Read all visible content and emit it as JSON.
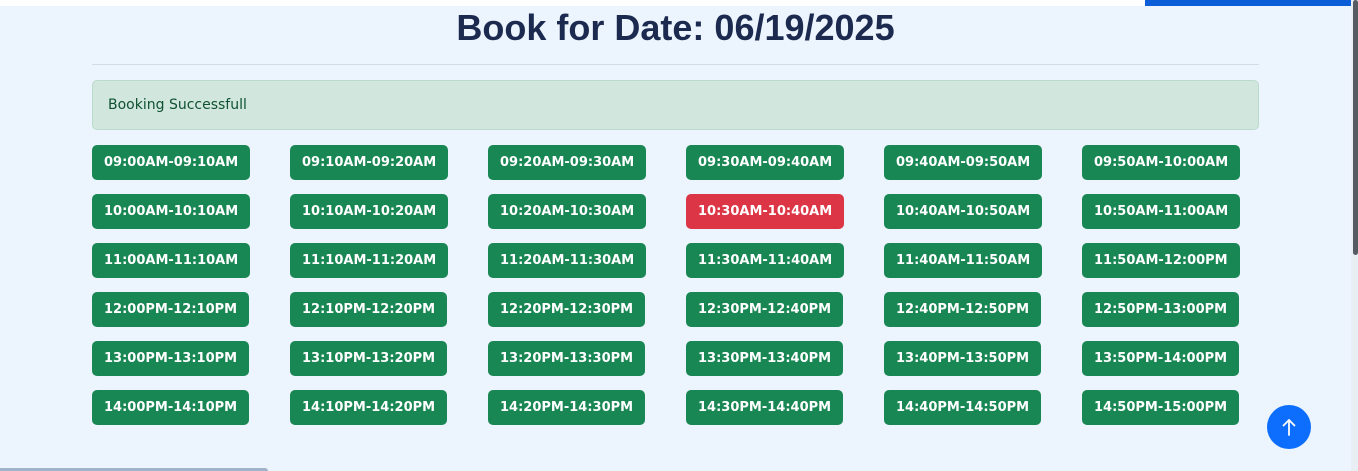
{
  "page": {
    "title": "Book for Date: 06/19/2025"
  },
  "alert": {
    "message": "Booking Successfull"
  },
  "colors": {
    "available": "#198754",
    "booked": "#dc3545",
    "title": "#1b2a4e",
    "alert_bg": "#d1e7dd",
    "alert_text": "#0f5132",
    "primary": "#0d6efd"
  },
  "slots": [
    {
      "label": "09:00AM-09:10AM",
      "status": "available"
    },
    {
      "label": "09:10AM-09:20AM",
      "status": "available"
    },
    {
      "label": "09:20AM-09:30AM",
      "status": "available"
    },
    {
      "label": "09:30AM-09:40AM",
      "status": "available"
    },
    {
      "label": "09:40AM-09:50AM",
      "status": "available"
    },
    {
      "label": "09:50AM-10:00AM",
      "status": "available"
    },
    {
      "label": "10:00AM-10:10AM",
      "status": "available"
    },
    {
      "label": "10:10AM-10:20AM",
      "status": "available"
    },
    {
      "label": "10:20AM-10:30AM",
      "status": "available"
    },
    {
      "label": "10:30AM-10:40AM",
      "status": "booked"
    },
    {
      "label": "10:40AM-10:50AM",
      "status": "available"
    },
    {
      "label": "10:50AM-11:00AM",
      "status": "available"
    },
    {
      "label": "11:00AM-11:10AM",
      "status": "available"
    },
    {
      "label": "11:10AM-11:20AM",
      "status": "available"
    },
    {
      "label": "11:20AM-11:30AM",
      "status": "available"
    },
    {
      "label": "11:30AM-11:40AM",
      "status": "available"
    },
    {
      "label": "11:40AM-11:50AM",
      "status": "available"
    },
    {
      "label": "11:50AM-12:00PM",
      "status": "available"
    },
    {
      "label": "12:00PM-12:10PM",
      "status": "available"
    },
    {
      "label": "12:10PM-12:20PM",
      "status": "available"
    },
    {
      "label": "12:20PM-12:30PM",
      "status": "available"
    },
    {
      "label": "12:30PM-12:40PM",
      "status": "available"
    },
    {
      "label": "12:40PM-12:50PM",
      "status": "available"
    },
    {
      "label": "12:50PM-13:00PM",
      "status": "available"
    },
    {
      "label": "13:00PM-13:10PM",
      "status": "available"
    },
    {
      "label": "13:10PM-13:20PM",
      "status": "available"
    },
    {
      "label": "13:20PM-13:30PM",
      "status": "available"
    },
    {
      "label": "13:30PM-13:40PM",
      "status": "available"
    },
    {
      "label": "13:40PM-13:50PM",
      "status": "available"
    },
    {
      "label": "13:50PM-14:00PM",
      "status": "available"
    },
    {
      "label": "14:00PM-14:10PM",
      "status": "available"
    },
    {
      "label": "14:10PM-14:20PM",
      "status": "available"
    },
    {
      "label": "14:20PM-14:30PM",
      "status": "available"
    },
    {
      "label": "14:30PM-14:40PM",
      "status": "available"
    },
    {
      "label": "14:40PM-14:50PM",
      "status": "available"
    },
    {
      "label": "14:50PM-15:00PM",
      "status": "available"
    }
  ],
  "scroll_top": {
    "icon": "arrow-up-icon"
  }
}
